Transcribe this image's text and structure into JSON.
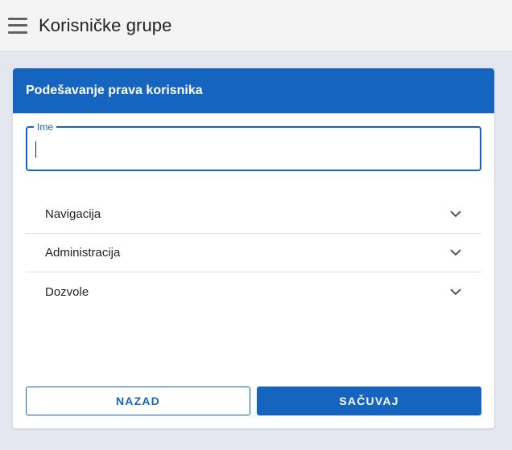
{
  "app_bar": {
    "title": "Korisničke grupe",
    "menu_icon": "hamburger-menu-icon"
  },
  "card": {
    "header": "Podešavanje prava korisnika",
    "name_field": {
      "label": "Ime",
      "value": "",
      "placeholder": ""
    },
    "sections": [
      {
        "label": "Navigacija",
        "icon": "chevron-down-icon"
      },
      {
        "label": "Administracija",
        "icon": "chevron-down-icon"
      },
      {
        "label": "Dozvole",
        "icon": "chevron-down-icon"
      }
    ],
    "buttons": {
      "back": "NAZAD",
      "save": "SAČUVAJ"
    }
  },
  "colors": {
    "primary": "#1565c0",
    "background": "#e4e7ef",
    "app_bar": "#f4f4f4"
  }
}
